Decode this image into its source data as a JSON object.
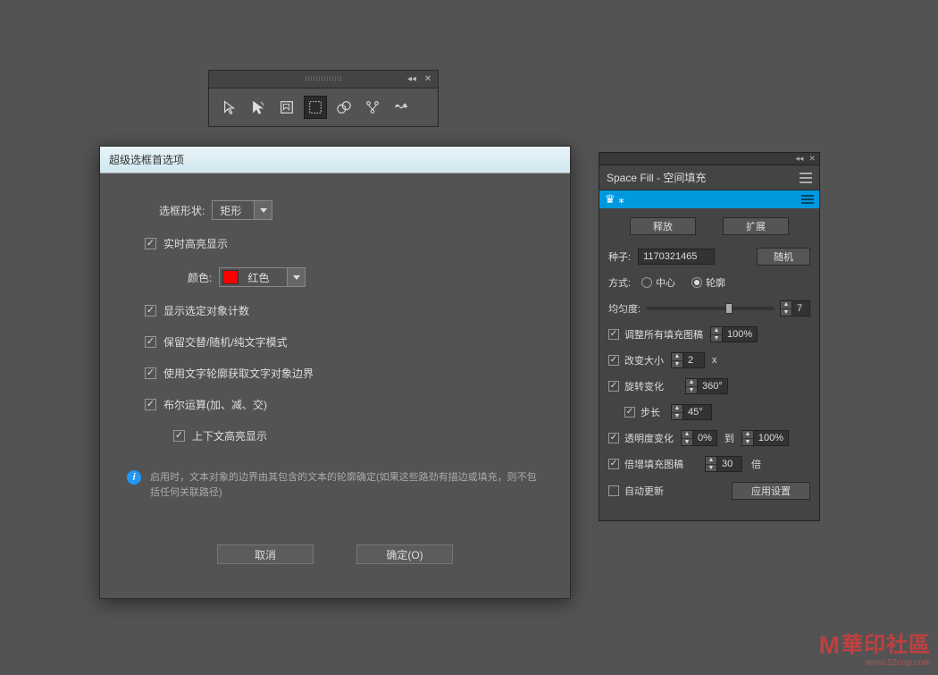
{
  "toolbar": {},
  "dialog": {
    "title": "超级选框首选项",
    "shape_label": "选框形状:",
    "shape_value": "矩形",
    "realtime_highlight": "实时高亮显示",
    "color_label": "颜色:",
    "color_value": "红色",
    "color_hex": "#ff0000",
    "show_count": "显示选定对象计数",
    "keep_mode": "保留交替/随机/纯文字模式",
    "use_text_outline": "使用文字轮廓获取文字对象边界",
    "boolean_ops": "布尔运算(加、减、交)",
    "context_highlight": "上下文高亮显示",
    "info_text": "启用时，文本对象的边界由其包含的文本的轮廓确定(如果这些路劲有描边或填充，则不包括任何关联路径)",
    "cancel": "取消",
    "ok": "确定(O)"
  },
  "panel": {
    "title": "Space Fill - 空间填充",
    "release": "释放",
    "expand": "扩展",
    "seed_label": "种子:",
    "seed_value": "1170321465",
    "random": "随机",
    "mode_label": "方式:",
    "mode_center": "中心",
    "mode_outline": "轮廓",
    "uniformity_label": "均匀度:",
    "uniformity_value": "7",
    "resize_all": "调整所有填充图稿",
    "resize_all_value": "100%",
    "change_size": "改变大小",
    "change_size_value": "2",
    "change_size_unit": "x",
    "rotate_change": "旋转变化",
    "rotate_value": "360°",
    "step_label": "步长",
    "step_value": "45°",
    "opacity_change": "透明度变化",
    "opacity_from": "0%",
    "opacity_to_label": "到",
    "opacity_to": "100%",
    "multiply_fill": "倍增填充图稿",
    "multiply_value": "30",
    "multiply_unit": "倍",
    "auto_update": "自动更新",
    "apply": "应用设置"
  },
  "watermark": {
    "text": "華印社區",
    "url": "www.52cnp.com"
  }
}
